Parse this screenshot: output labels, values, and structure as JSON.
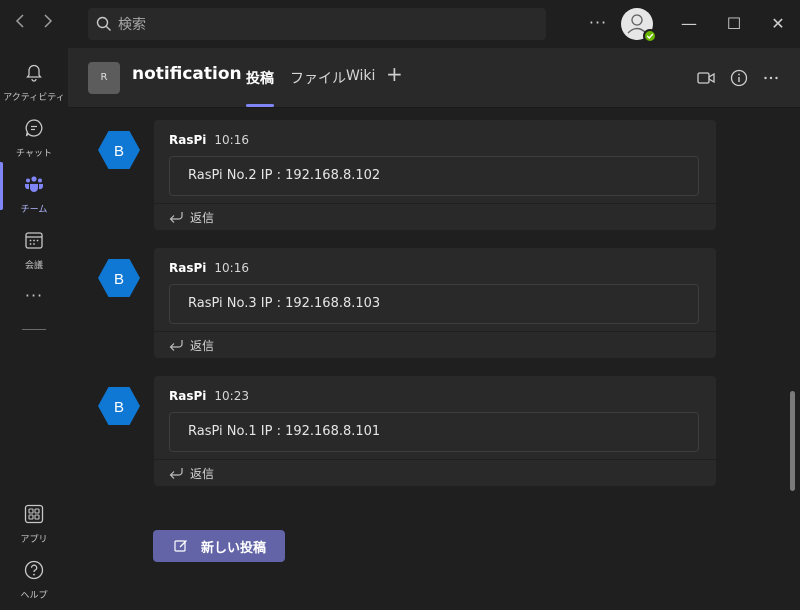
{
  "titlebar": {
    "search_placeholder": "検索",
    "more_label": "···",
    "minimize_glyph": "—",
    "maximize_glyph": "☐",
    "close_glyph": "✕",
    "status_color": "#6bb700"
  },
  "rail": {
    "items": [
      {
        "label": "アクティビティ",
        "icon": "bell-icon"
      },
      {
        "label": "チャット",
        "icon": "chat-icon"
      },
      {
        "label": "チーム",
        "icon": "teams-icon",
        "active": true
      },
      {
        "label": "会議",
        "icon": "calendar-icon"
      },
      {
        "label": "アプリ",
        "icon": "apps-icon"
      },
      {
        "label": "ヘルプ",
        "icon": "help-icon"
      }
    ],
    "more_label": "···",
    "accent": "#7f85f5"
  },
  "channel": {
    "team_avatar_letter": "R",
    "title": "notification",
    "tabs": [
      {
        "label": "投稿",
        "active": true
      },
      {
        "label": "ファイル"
      },
      {
        "label": "Wiki"
      }
    ],
    "add_tab_label": "+"
  },
  "messages": [
    {
      "avatar_letter": "B",
      "author": "RasPi",
      "time": "10:16",
      "card_text": "RasPi No.2 IP : 192.168.8.102",
      "reply_label": "返信"
    },
    {
      "avatar_letter": "B",
      "author": "RasPi",
      "time": "10:16",
      "card_text": "RasPi No.3 IP : 192.168.8.103",
      "reply_label": "返信"
    },
    {
      "avatar_letter": "B",
      "author": "RasPi",
      "time": "10:23",
      "card_text": "RasPi No.1 IP : 192.168.8.101",
      "reply_label": "返信"
    }
  ],
  "new_post_label": "新しい投稿",
  "colors": {
    "avatar_hex": "#0f78d4",
    "new_post_button": "#6264a7"
  }
}
